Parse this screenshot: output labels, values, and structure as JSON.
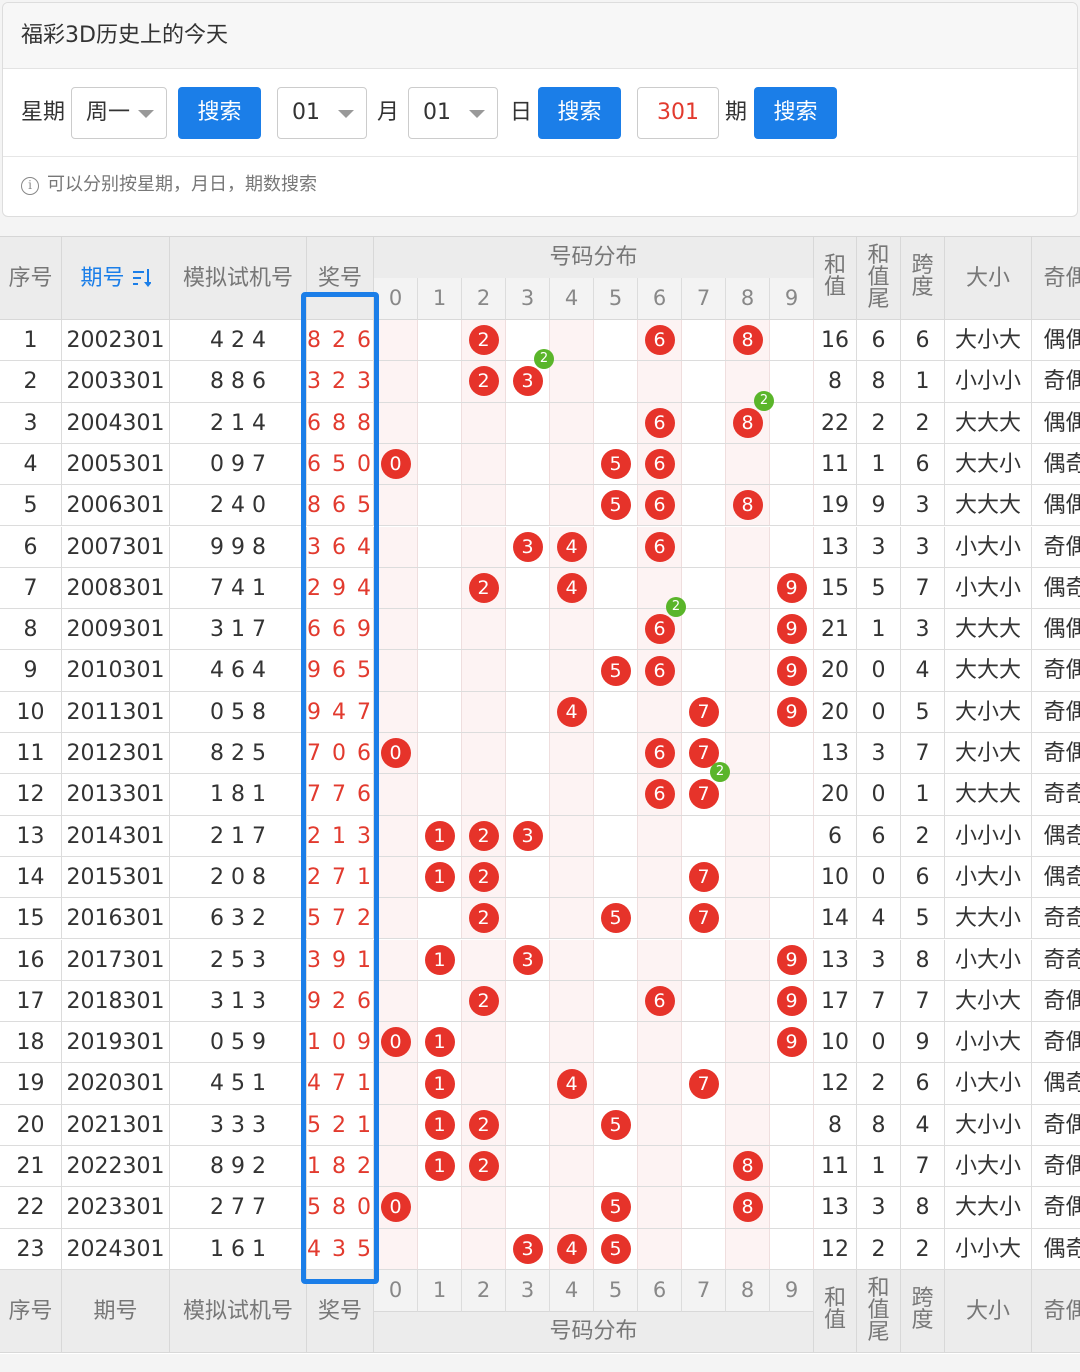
{
  "panel": {
    "title": "福彩3D历史上的今天",
    "weekday_label": "星期",
    "weekday_value": "周一",
    "search_label": "搜索",
    "month_value": "01",
    "month_label": "月",
    "day_value": "01",
    "day_label": "日",
    "period_value": "301",
    "period_label": "期",
    "hint": "可以分别按星期，月日，期数搜索"
  },
  "table": {
    "headers": {
      "seq": "序号",
      "period": "期号",
      "sort_icon": "sort-icon",
      "trial": "模拟试机号",
      "award": "奖号",
      "dist": "号码分布",
      "sum": "和值",
      "sum_tail": "和值尾",
      "span": "跨度",
      "size": "大小",
      "parity": "奇偶"
    },
    "digits": [
      "0",
      "1",
      "2",
      "3",
      "4",
      "5",
      "6",
      "7",
      "8",
      "9"
    ],
    "rows": [
      {
        "seq": "1",
        "period": "2002301",
        "trial": "4 2 4",
        "award": "8 2 6",
        "balls": [
          2,
          6,
          8
        ],
        "badge": null,
        "sum": "16",
        "tail": "6",
        "span": "6",
        "size": "大小大",
        "parity": "偶偶"
      },
      {
        "seq": "2",
        "period": "2003301",
        "trial": "8 8 6",
        "award": "3 2 3",
        "balls": [
          2,
          3
        ],
        "badge": {
          "digit": 3,
          "text": "2"
        },
        "sum": "8",
        "tail": "8",
        "span": "1",
        "size": "小小小",
        "parity": "奇偶"
      },
      {
        "seq": "3",
        "period": "2004301",
        "trial": "2 1 4",
        "award": "6 8 8",
        "balls": [
          6,
          8
        ],
        "badge": {
          "digit": 8,
          "text": "2"
        },
        "sum": "22",
        "tail": "2",
        "span": "2",
        "size": "大大大",
        "parity": "偶偶"
      },
      {
        "seq": "4",
        "period": "2005301",
        "trial": "0 9 7",
        "award": "6 5 0",
        "balls": [
          0,
          5,
          6
        ],
        "badge": null,
        "sum": "11",
        "tail": "1",
        "span": "6",
        "size": "大大小",
        "parity": "偶奇"
      },
      {
        "seq": "5",
        "period": "2006301",
        "trial": "2 4 0",
        "award": "8 6 5",
        "balls": [
          5,
          6,
          8
        ],
        "badge": null,
        "sum": "19",
        "tail": "9",
        "span": "3",
        "size": "大大大",
        "parity": "偶偶"
      },
      {
        "seq": "6",
        "period": "2007301",
        "trial": "9 9 8",
        "award": "3 6 4",
        "balls": [
          3,
          4,
          6
        ],
        "badge": null,
        "sum": "13",
        "tail": "3",
        "span": "3",
        "size": "小大小",
        "parity": "奇偶"
      },
      {
        "seq": "7",
        "period": "2008301",
        "trial": "7 4 1",
        "award": "2 9 4",
        "balls": [
          2,
          4,
          9
        ],
        "badge": null,
        "sum": "15",
        "tail": "5",
        "span": "7",
        "size": "小大小",
        "parity": "偶奇"
      },
      {
        "seq": "8",
        "period": "2009301",
        "trial": "3 1 7",
        "award": "6 6 9",
        "balls": [
          6,
          9
        ],
        "badge": {
          "digit": 6,
          "text": "2"
        },
        "sum": "21",
        "tail": "1",
        "span": "3",
        "size": "大大大",
        "parity": "偶偶"
      },
      {
        "seq": "9",
        "period": "2010301",
        "trial": "4 6 4",
        "award": "9 6 5",
        "balls": [
          5,
          6,
          9
        ],
        "badge": null,
        "sum": "20",
        "tail": "0",
        "span": "4",
        "size": "大大大",
        "parity": "奇偶"
      },
      {
        "seq": "10",
        "period": "2011301",
        "trial": "0 5 8",
        "award": "9 4 7",
        "balls": [
          4,
          7,
          9
        ],
        "badge": null,
        "sum": "20",
        "tail": "0",
        "span": "5",
        "size": "大小大",
        "parity": "奇偶"
      },
      {
        "seq": "11",
        "period": "2012301",
        "trial": "8 2 5",
        "award": "7 0 6",
        "balls": [
          0,
          6,
          7
        ],
        "badge": null,
        "sum": "13",
        "tail": "3",
        "span": "7",
        "size": "大小大",
        "parity": "奇偶"
      },
      {
        "seq": "12",
        "period": "2013301",
        "trial": "1 8 1",
        "award": "7 7 6",
        "balls": [
          6,
          7
        ],
        "badge": {
          "digit": 7,
          "text": "2"
        },
        "sum": "20",
        "tail": "0",
        "span": "1",
        "size": "大大大",
        "parity": "奇奇"
      },
      {
        "seq": "13",
        "period": "2014301",
        "trial": "2 1 7",
        "award": "2 1 3",
        "balls": [
          1,
          2,
          3
        ],
        "badge": null,
        "sum": "6",
        "tail": "6",
        "span": "2",
        "size": "小小小",
        "parity": "偶奇"
      },
      {
        "seq": "14",
        "period": "2015301",
        "trial": "2 0 8",
        "award": "2 7 1",
        "balls": [
          1,
          2,
          7
        ],
        "badge": null,
        "sum": "10",
        "tail": "0",
        "span": "6",
        "size": "小大小",
        "parity": "偶奇"
      },
      {
        "seq": "15",
        "period": "2016301",
        "trial": "6 3 2",
        "award": "5 7 2",
        "balls": [
          2,
          5,
          7
        ],
        "badge": null,
        "sum": "14",
        "tail": "4",
        "span": "5",
        "size": "大大小",
        "parity": "奇奇"
      },
      {
        "seq": "16",
        "period": "2017301",
        "trial": "2 5 3",
        "award": "3 9 1",
        "balls": [
          1,
          3,
          9
        ],
        "badge": null,
        "sum": "13",
        "tail": "3",
        "span": "8",
        "size": "小大小",
        "parity": "奇奇"
      },
      {
        "seq": "17",
        "period": "2018301",
        "trial": "3 1 3",
        "award": "9 2 6",
        "balls": [
          2,
          6,
          9
        ],
        "badge": null,
        "sum": "17",
        "tail": "7",
        "span": "7",
        "size": "大小大",
        "parity": "奇偶"
      },
      {
        "seq": "18",
        "period": "2019301",
        "trial": "0 5 9",
        "award": "1 0 9",
        "balls": [
          0,
          1,
          9
        ],
        "badge": null,
        "sum": "10",
        "tail": "0",
        "span": "9",
        "size": "小小大",
        "parity": "奇偶"
      },
      {
        "seq": "19",
        "period": "2020301",
        "trial": "4 5 1",
        "award": "4 7 1",
        "balls": [
          1,
          4,
          7
        ],
        "badge": null,
        "sum": "12",
        "tail": "2",
        "span": "6",
        "size": "小大小",
        "parity": "偶奇"
      },
      {
        "seq": "20",
        "period": "2021301",
        "trial": "3 3 3",
        "award": "5 2 1",
        "balls": [
          1,
          2,
          5
        ],
        "badge": null,
        "sum": "8",
        "tail": "8",
        "span": "4",
        "size": "大小小",
        "parity": "奇偶"
      },
      {
        "seq": "21",
        "period": "2022301",
        "trial": "8 9 2",
        "award": "1 8 2",
        "balls": [
          1,
          2,
          8
        ],
        "badge": null,
        "sum": "11",
        "tail": "1",
        "span": "7",
        "size": "小大小",
        "parity": "奇偶"
      },
      {
        "seq": "22",
        "period": "2023301",
        "trial": "2 7 7",
        "award": "5 8 0",
        "balls": [
          0,
          5,
          8
        ],
        "badge": null,
        "sum": "13",
        "tail": "3",
        "span": "8",
        "size": "大大小",
        "parity": "奇偶"
      },
      {
        "seq": "23",
        "period": "2024301",
        "trial": "1 6 1",
        "award": "4 3 5",
        "balls": [
          3,
          4,
          5
        ],
        "badge": null,
        "sum": "12",
        "tail": "2",
        "span": "2",
        "size": "小小大",
        "parity": "偶奇"
      }
    ]
  },
  "colors": {
    "accent": "#1b7ee8",
    "ball": "#e6332a",
    "badge": "#5ab52a",
    "award_text": "#e23a2e"
  }
}
